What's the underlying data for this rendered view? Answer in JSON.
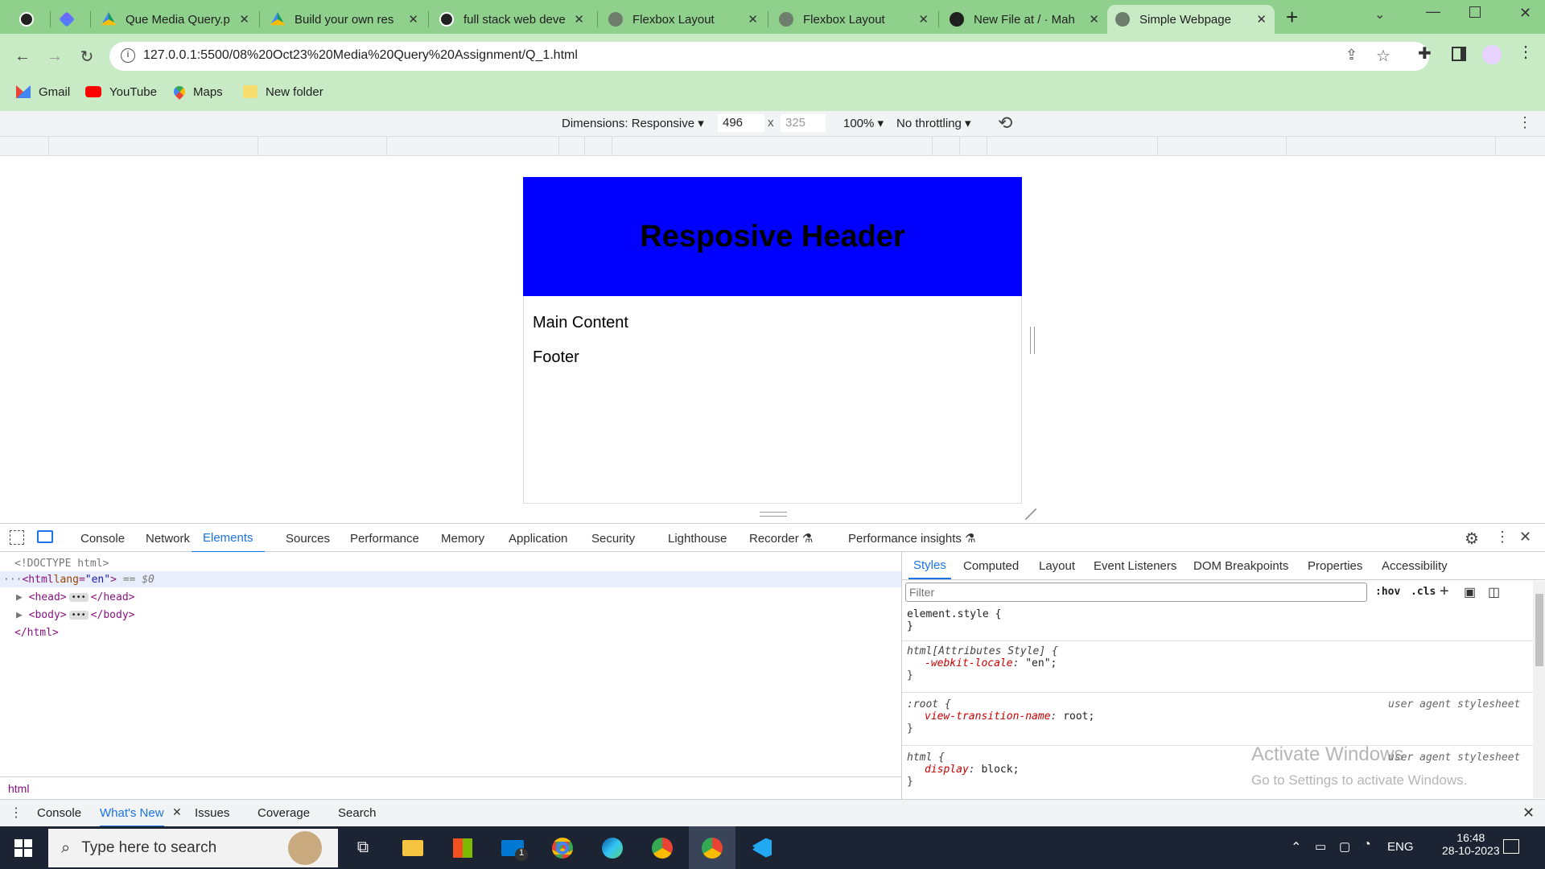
{
  "browser": {
    "tabs": [
      {
        "title": "",
        "icon": "wordpress-icon"
      },
      {
        "title": "",
        "icon": "sparkle-icon"
      },
      {
        "title": "Que Media Query.p",
        "icon": "google-drive-icon"
      },
      {
        "title": "Build your own res",
        "icon": "google-drive-icon"
      },
      {
        "title": "full stack web deve",
        "icon": "wordpress-icon"
      },
      {
        "title": "Flexbox Layout",
        "icon": "globe-icon"
      },
      {
        "title": "Flexbox Layout",
        "icon": "globe-icon"
      },
      {
        "title": "New File at / · Mah",
        "icon": "github-icon"
      },
      {
        "title": "Simple Webpage",
        "icon": "globe-icon",
        "active": true
      }
    ],
    "new_tab": "+",
    "url": "127.0.0.1:5500/08%20Oct23%20Media%20Query%20Assignment/Q_1.html",
    "bookmarks": [
      "Gmail",
      "YouTube",
      "Maps",
      "New folder"
    ]
  },
  "device_toolbar": {
    "dimensions_label": "Dimensions: Responsive",
    "width": "496",
    "x": "x",
    "height_placeholder": "325",
    "zoom": "100%",
    "throttling": "No throttling"
  },
  "page": {
    "header": "Resposive Header",
    "main": "Main Content",
    "footer": "Footer"
  },
  "devtools": {
    "tabs": [
      "Console",
      "Network",
      "Elements",
      "Sources",
      "Performance",
      "Memory",
      "Application",
      "Security",
      "Lighthouse",
      "Recorder",
      "Performance insights"
    ],
    "selected_tab": "Elements",
    "dom": {
      "doctype": "<!DOCTYPE html>",
      "html_open": "<html ",
      "html_attr": "lang",
      "html_val": "\"en\"",
      "html_close": ">",
      "selected_marker": "== $0",
      "head": "<head>",
      "head_close": "</head>",
      "body": "<body>",
      "body_close": "</body>",
      "html_end": "</html>"
    },
    "styles_tabs": [
      "Styles",
      "Computed",
      "Layout",
      "Event Listeners",
      "DOM Breakpoints",
      "Properties",
      "Accessibility"
    ],
    "filter_placeholder": "Filter",
    "hov": ":hov",
    "cls": ".cls",
    "rules": {
      "r1_selector": "element.style {",
      "r1_close": "}",
      "r2_selector": "html[Attributes Style] {",
      "r2_prop": "-webkit-locale",
      "r2_val": "\"en\";",
      "r2_close": "}",
      "r3_selector": ":root {",
      "r3_source": "user agent stylesheet",
      "r3_prop": "view-transition-name",
      "r3_val": "root;",
      "r3_close": "}",
      "r4_selector": "html {",
      "r4_source": "user agent stylesheet",
      "r4_prop": "display",
      "r4_val": "block;",
      "r4_close": "}"
    },
    "breadcrumb": "html",
    "drawer_tabs": [
      "Console",
      "What's New",
      "Issues",
      "Coverage",
      "Search"
    ],
    "watermark_title": "Activate Windows",
    "watermark_sub": "Go to Settings to activate Windows."
  },
  "taskbar": {
    "search_placeholder": "Type here to search",
    "lang": "ENG",
    "time": "16:48",
    "date": "28-10-2023",
    "mail_badge": "1"
  }
}
